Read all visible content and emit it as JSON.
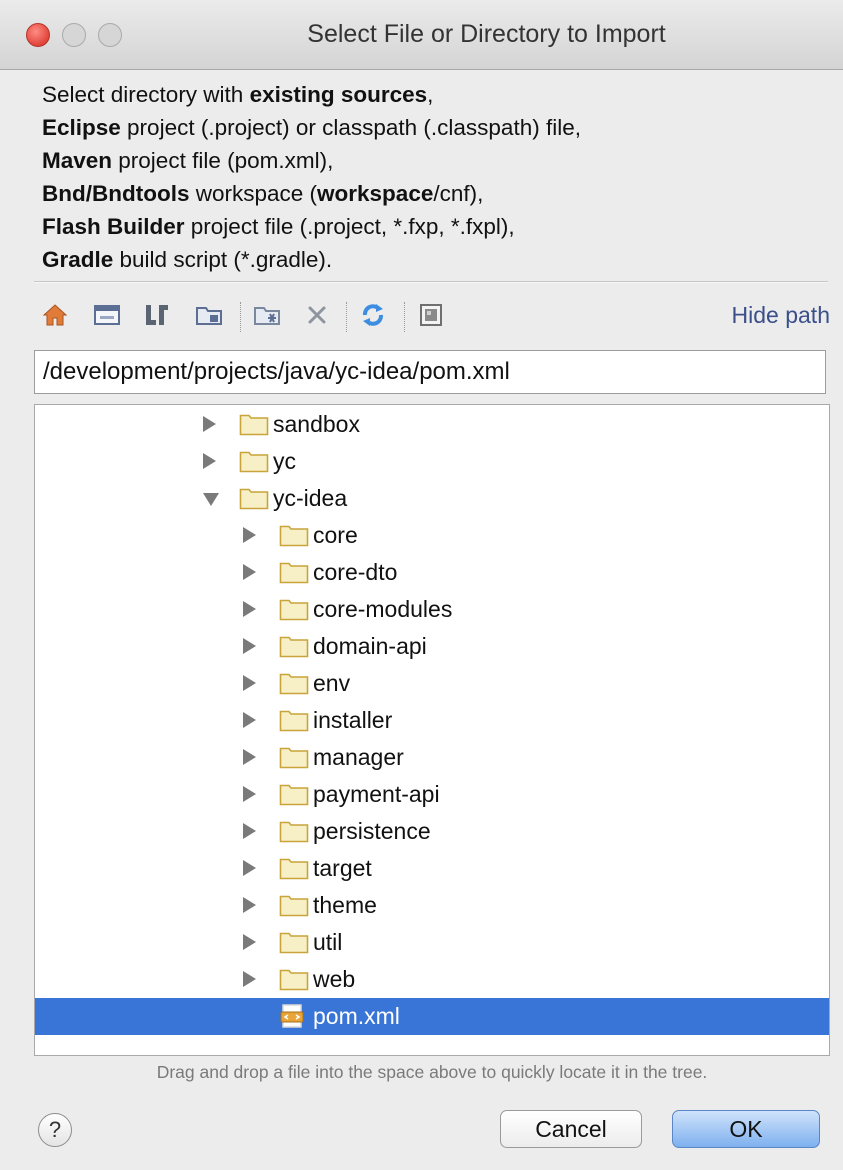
{
  "window": {
    "title": "Select File or Directory to Import"
  },
  "description": {
    "lines": [
      [
        {
          "t": "Select directory with ",
          "b": false
        },
        {
          "t": "existing sources",
          "b": true
        },
        {
          "t": ",",
          "b": false
        }
      ],
      [
        {
          "t": "Eclipse",
          "b": true
        },
        {
          "t": " project (.project) or classpath (.classpath) file,",
          "b": false
        }
      ],
      [
        {
          "t": "Maven",
          "b": true
        },
        {
          "t": " project file (pom.xml),",
          "b": false
        }
      ],
      [
        {
          "t": "Bnd/Bndtools",
          "b": true
        },
        {
          "t": " workspace (",
          "b": false
        },
        {
          "t": "workspace",
          "b": true
        },
        {
          "t": "/cnf),",
          "b": false
        }
      ],
      [
        {
          "t": "Flash Builder",
          "b": true
        },
        {
          "t": " project file (.project, *.fxp, *.fxpl),",
          "b": false
        }
      ],
      [
        {
          "t": "Gradle",
          "b": true
        },
        {
          "t": " build script (*.gradle).",
          "b": false
        }
      ]
    ]
  },
  "toolbar": {
    "icons": [
      "home-icon",
      "desktop-icon",
      "project-icon",
      "module-icon",
      "new-folder-icon",
      "delete-icon",
      "refresh-icon",
      "show-hidden-icon"
    ],
    "hide_path_label": "Hide path"
  },
  "path": {
    "value": "/development/projects/java/yc-idea/pom.xml"
  },
  "tree": {
    "rows": [
      {
        "label": "sandbox",
        "depth": 0,
        "expander": "collapsed",
        "kind": "folder"
      },
      {
        "label": "yc",
        "depth": 0,
        "expander": "collapsed",
        "kind": "folder"
      },
      {
        "label": "yc-idea",
        "depth": 0,
        "expander": "expanded",
        "kind": "folder"
      },
      {
        "label": "core",
        "depth": 1,
        "expander": "collapsed",
        "kind": "folder"
      },
      {
        "label": "core-dto",
        "depth": 1,
        "expander": "collapsed",
        "kind": "folder"
      },
      {
        "label": "core-modules",
        "depth": 1,
        "expander": "collapsed",
        "kind": "folder"
      },
      {
        "label": "domain-api",
        "depth": 1,
        "expander": "collapsed",
        "kind": "folder"
      },
      {
        "label": "env",
        "depth": 1,
        "expander": "collapsed",
        "kind": "folder"
      },
      {
        "label": "installer",
        "depth": 1,
        "expander": "collapsed",
        "kind": "folder"
      },
      {
        "label": "manager",
        "depth": 1,
        "expander": "collapsed",
        "kind": "folder"
      },
      {
        "label": "payment-api",
        "depth": 1,
        "expander": "collapsed",
        "kind": "folder"
      },
      {
        "label": "persistence",
        "depth": 1,
        "expander": "collapsed",
        "kind": "folder"
      },
      {
        "label": "target",
        "depth": 1,
        "expander": "collapsed",
        "kind": "folder"
      },
      {
        "label": "theme",
        "depth": 1,
        "expander": "collapsed",
        "kind": "folder"
      },
      {
        "label": "util",
        "depth": 1,
        "expander": "collapsed",
        "kind": "folder"
      },
      {
        "label": "web",
        "depth": 1,
        "expander": "collapsed",
        "kind": "folder"
      },
      {
        "label": "pom.xml",
        "depth": 1,
        "expander": "none",
        "kind": "file",
        "selected": true
      }
    ]
  },
  "hint": "Drag and drop a file into the space above to quickly locate it in the tree.",
  "buttons": {
    "help": "?",
    "cancel": "Cancel",
    "ok": "OK"
  },
  "colors": {
    "selection": "#3875d7",
    "folder_fill": "#f7f0c7",
    "folder_stroke": "#c9a43a",
    "link": "#3b4f8a"
  }
}
